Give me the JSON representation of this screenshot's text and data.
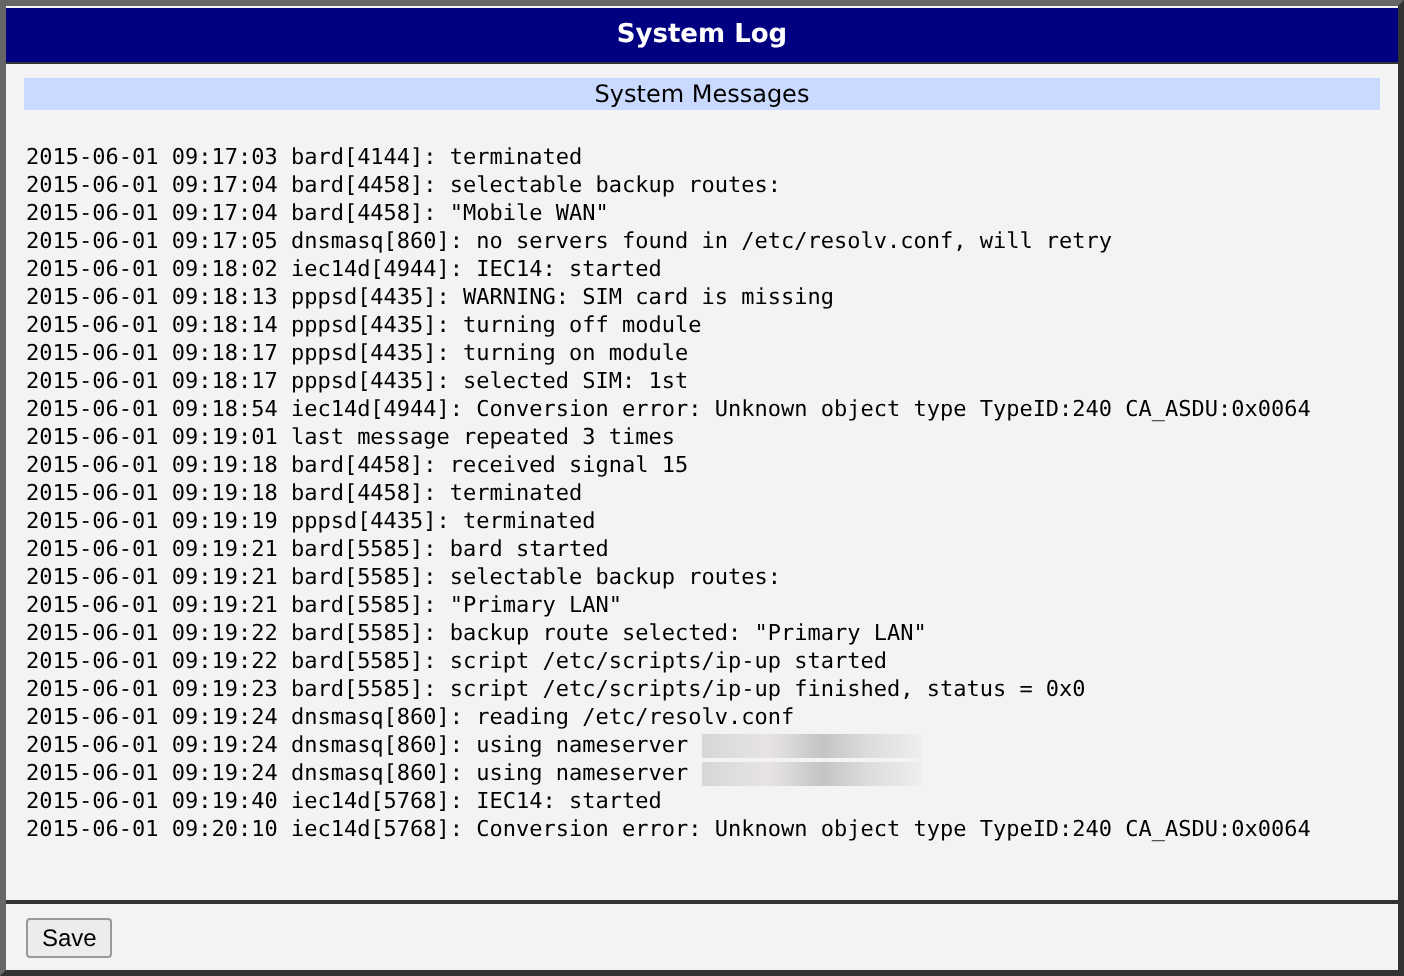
{
  "window": {
    "title": "System Log"
  },
  "section": {
    "title": "System Messages"
  },
  "log": [
    {
      "text": "2015-06-01 09:17:03 bard[4144]: terminated",
      "redacted": false
    },
    {
      "text": "2015-06-01 09:17:04 bard[4458]: selectable backup routes:",
      "redacted": false
    },
    {
      "text": "2015-06-01 09:17:04 bard[4458]: \"Mobile WAN\"",
      "redacted": false
    },
    {
      "text": "2015-06-01 09:17:05 dnsmasq[860]: no servers found in /etc/resolv.conf, will retry",
      "redacted": false
    },
    {
      "text": "2015-06-01 09:18:02 iec14d[4944]: IEC14: started",
      "redacted": false
    },
    {
      "text": "2015-06-01 09:18:13 pppsd[4435]: WARNING: SIM card is missing",
      "redacted": false
    },
    {
      "text": "2015-06-01 09:18:14 pppsd[4435]: turning off module",
      "redacted": false
    },
    {
      "text": "2015-06-01 09:18:17 pppsd[4435]: turning on module",
      "redacted": false
    },
    {
      "text": "2015-06-01 09:18:17 pppsd[4435]: selected SIM: 1st",
      "redacted": false
    },
    {
      "text": "2015-06-01 09:18:54 iec14d[4944]: Conversion error: Unknown object type TypeID:240 CA_ASDU:0x0064",
      "redacted": false
    },
    {
      "text": "2015-06-01 09:19:01 last message repeated 3 times",
      "redacted": false
    },
    {
      "text": "2015-06-01 09:19:18 bard[4458]: received signal 15",
      "redacted": false
    },
    {
      "text": "2015-06-01 09:19:18 bard[4458]: terminated",
      "redacted": false
    },
    {
      "text": "2015-06-01 09:19:19 pppsd[4435]: terminated",
      "redacted": false
    },
    {
      "text": "2015-06-01 09:19:21 bard[5585]: bard started",
      "redacted": false
    },
    {
      "text": "2015-06-01 09:19:21 bard[5585]: selectable backup routes:",
      "redacted": false
    },
    {
      "text": "2015-06-01 09:19:21 bard[5585]: \"Primary LAN\"",
      "redacted": false
    },
    {
      "text": "2015-06-01 09:19:22 bard[5585]: backup route selected: \"Primary LAN\"",
      "redacted": false
    },
    {
      "text": "2015-06-01 09:19:22 bard[5585]: script /etc/scripts/ip-up started",
      "redacted": false
    },
    {
      "text": "2015-06-01 09:19:23 bard[5585]: script /etc/scripts/ip-up finished, status = 0x0",
      "redacted": false
    },
    {
      "text": "2015-06-01 09:19:24 dnsmasq[860]: reading /etc/resolv.conf",
      "redacted": false
    },
    {
      "text": "2015-06-01 09:19:24 dnsmasq[860]: using nameserver",
      "redacted": true
    },
    {
      "text": "2015-06-01 09:19:24 dnsmasq[860]: using nameserver",
      "redacted": true
    },
    {
      "text": "2015-06-01 09:19:40 iec14d[5768]: IEC14: started",
      "redacted": false
    },
    {
      "text": "2015-06-01 09:20:10 iec14d[5768]: Conversion error: Unknown object type TypeID:240 CA_ASDU:0x0064",
      "redacted": false
    }
  ],
  "buttons": [
    {
      "label": "Save"
    }
  ]
}
